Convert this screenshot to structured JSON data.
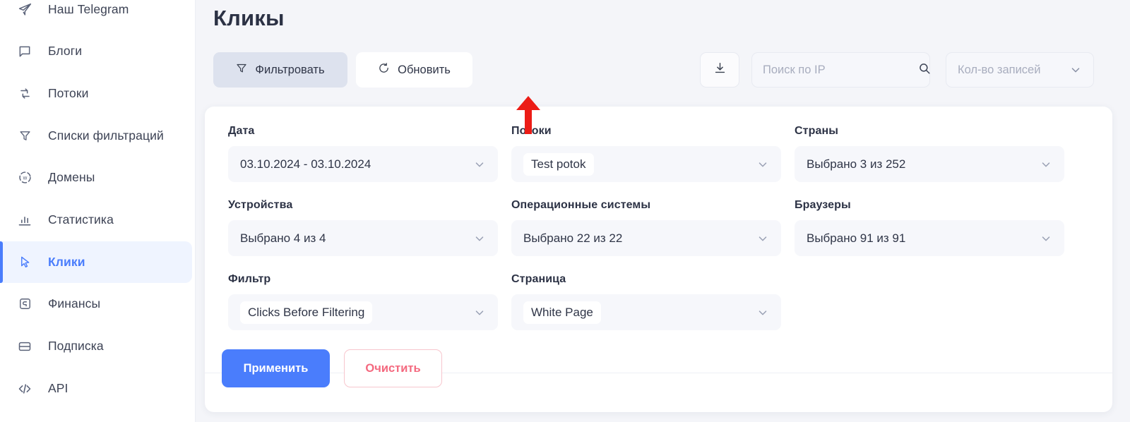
{
  "sidebar": {
    "items": [
      {
        "label": "Наш Telegram",
        "icon": "telegram-icon",
        "active": false
      },
      {
        "label": "Блоги",
        "icon": "chat-icon",
        "active": false
      },
      {
        "label": "Потоки",
        "icon": "flows-icon",
        "active": false
      },
      {
        "label": "Списки фильтраций",
        "icon": "filter-list-icon",
        "active": false
      },
      {
        "label": "Домены",
        "icon": "domains-icon",
        "active": false
      },
      {
        "label": "Статистика",
        "icon": "stats-icon",
        "active": false
      },
      {
        "label": "Клики",
        "icon": "cursor-icon",
        "active": true
      },
      {
        "label": "Финансы",
        "icon": "finance-icon",
        "active": false
      },
      {
        "label": "Подписка",
        "icon": "subscription-icon",
        "active": false
      },
      {
        "label": "API",
        "icon": "code-icon",
        "active": false
      }
    ]
  },
  "header": {
    "title": "Кликы"
  },
  "toolbar": {
    "filter_label": "Фильтровать",
    "filter_icon": "funnel-icon",
    "refresh_label": "Обновить",
    "refresh_icon": "refresh-icon",
    "download_icon": "download-icon",
    "search_placeholder": "Поиск по IP",
    "search_value": "",
    "search_icon": "search-icon",
    "records_label": "Кол-во записей",
    "records_icon": "chevron-down-icon"
  },
  "filters": [
    {
      "label": "Дата",
      "value": "03.10.2024 - 03.10.2024",
      "chip": false
    },
    {
      "label": "Потоки",
      "value": "Test potok",
      "chip": true
    },
    {
      "label": "Страны",
      "value": "Выбрано 3 из 252",
      "chip": false
    },
    {
      "label": "Устройства",
      "value": "Выбрано 4 из 4",
      "chip": false
    },
    {
      "label": "Операционные системы",
      "value": "Выбрано 22 из 22",
      "chip": false
    },
    {
      "label": "Браузеры",
      "value": "Выбрано 91 из 91",
      "chip": false
    },
    {
      "label": "Фильтр",
      "value": "Clicks Before Filtering",
      "chip": true
    },
    {
      "label": "Страница",
      "value": "White Page",
      "chip": true
    }
  ],
  "actions": {
    "apply_label": "Применить",
    "clear_label": "Очистить"
  },
  "annotation": {
    "arrow_icon": "up-arrow-annotation",
    "color": "#ec1c16"
  },
  "colors": {
    "accent": "#4a7dfc",
    "sidebar_active_bg": "#eff4ff",
    "danger": "#f4697f",
    "page_bg": "#f4f5f9",
    "card_bg": "#ffffff",
    "field_bg": "#f6f7fb"
  }
}
